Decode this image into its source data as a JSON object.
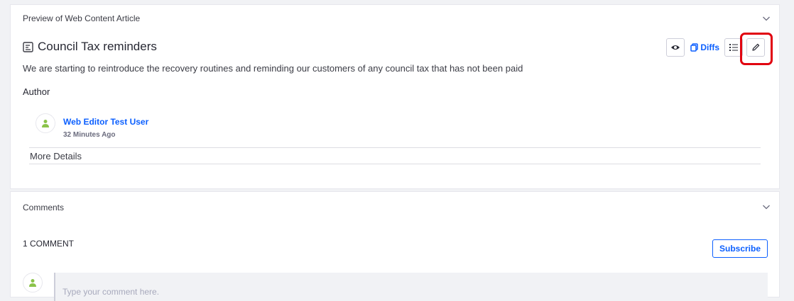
{
  "preview": {
    "panel_title": "Preview of Web Content Article",
    "article_title": "Council Tax reminders",
    "summary": "We are starting to reintroduce the recovery routines and reminding our customers of any council tax that has not been paid",
    "author_label": "Author",
    "author_name": "Web Editor Test User",
    "author_time": "32 Minutes Ago",
    "more_details": "More Details",
    "toolbar": {
      "diffs_label": "Diffs",
      "icons": [
        "eye-icon",
        "copy-icon",
        "list-icon",
        "pencil-icon"
      ]
    }
  },
  "comments": {
    "panel_title": "Comments",
    "count_label": "1 COMMENT",
    "subscribe_label": "Subscribe",
    "input_placeholder": "Type your comment here."
  },
  "colors": {
    "accent": "#0b5fff",
    "highlight": "#e1000f",
    "avatar_green": "#8bc34a"
  }
}
